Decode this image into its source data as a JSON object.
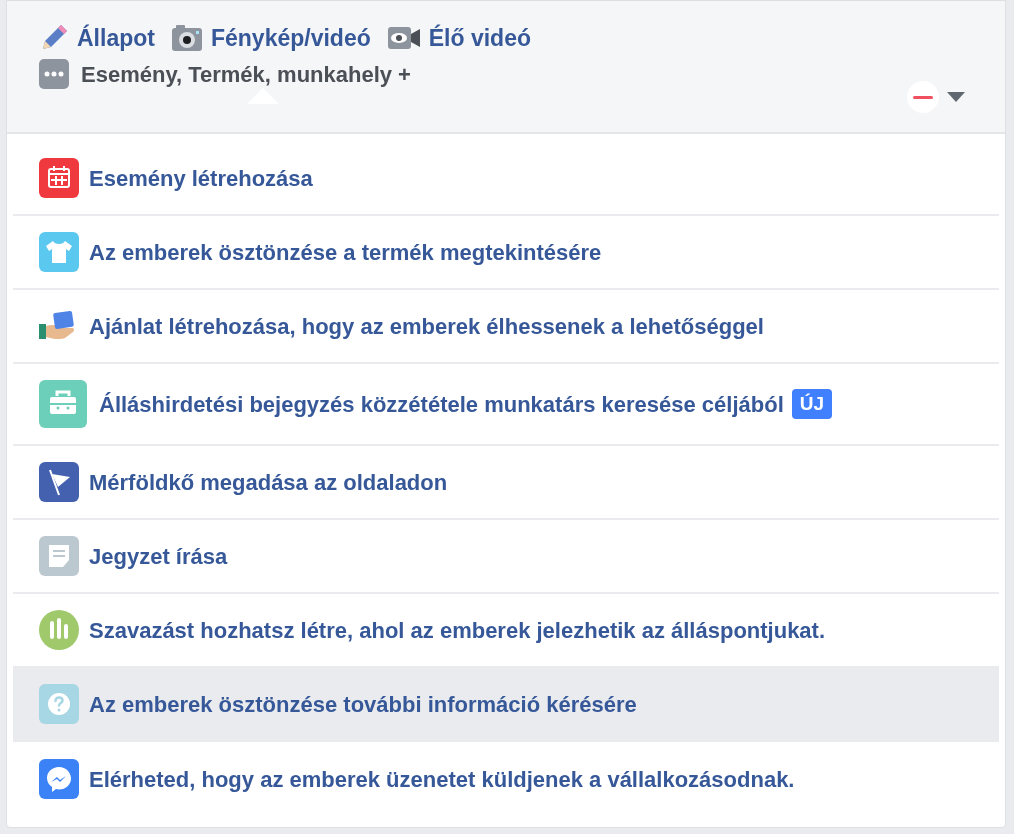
{
  "composer_tabs": [
    {
      "kind": "pencil",
      "label": "Állapot"
    },
    {
      "kind": "camera",
      "label": "Fénykép/videó"
    },
    {
      "kind": "video",
      "label": "Élő videó"
    }
  ],
  "more_link": {
    "label": "Esemény, Termék, munkahely +"
  },
  "menu": [
    {
      "kind": "calendar",
      "label": "Esemény létrehozása",
      "selected": false
    },
    {
      "kind": "shirt",
      "label": "Az emberek ösztönzése a termék megtekintésére",
      "selected": false
    },
    {
      "kind": "offer",
      "label": "Ajánlat létrehozása, hogy az emberek élhessenek a lehetőséggel",
      "selected": false
    },
    {
      "kind": "briefcase",
      "label": "Álláshirdetési bejegyzés közzététele munkatárs keresése céljából",
      "badge": "ÚJ",
      "selected": false
    },
    {
      "kind": "flag",
      "label": "Mérföldkő megadása az oldaladon",
      "selected": false
    },
    {
      "kind": "note",
      "label": "Jegyzet írása",
      "selected": false
    },
    {
      "kind": "poll",
      "label": "Szavazást hozhatsz létre, ahol az emberek jelezhetik az álláspontjukat.",
      "selected": false
    },
    {
      "kind": "question",
      "label": "Az emberek ösztönzése további információ kérésére",
      "selected": true
    },
    {
      "kind": "messenger",
      "label": "Elérheted, hogy az emberek üzenetet küldjenek a vállalkozásodnak.",
      "selected": false
    }
  ]
}
